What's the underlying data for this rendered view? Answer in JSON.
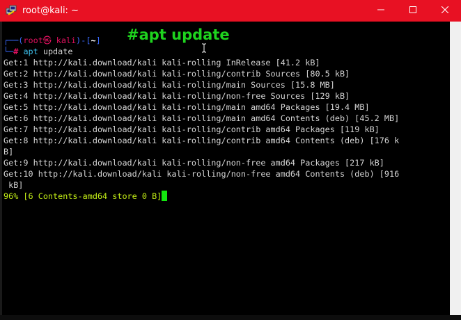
{
  "window": {
    "title": "root@kali: ~",
    "icon": "putty-icon",
    "accent_color": "#e81123"
  },
  "titlebar_buttons": {
    "minimize": "minimize-icon",
    "maximize": "maximize-icon",
    "close": "close-icon"
  },
  "annotation": "#apt update",
  "prompt": {
    "corner_top": "┌──(",
    "user": "root㉿ kali",
    "mid": ")-[",
    "path": "~",
    "close": "]",
    "corner_bottom": "└─",
    "hash": "#",
    "command": "apt",
    "args": " update"
  },
  "output_lines": [
    "Get:1 http://kali.download/kali kali-rolling InRelease [41.2 kB]",
    "Get:2 http://kali.download/kali kali-rolling/contrib Sources [80.5 kB]",
    "Get:3 http://kali.download/kali kali-rolling/main Sources [15.8 MB]",
    "Get:4 http://kali.download/kali kali-rolling/non-free Sources [129 kB]",
    "Get:5 http://kali.download/kali kali-rolling/main amd64 Packages [19.4 MB]",
    "Get:6 http://kali.download/kali kali-rolling/main amd64 Contents (deb) [45.2 MB]",
    "Get:7 http://kali.download/kali kali-rolling/contrib amd64 Packages [119 kB]",
    "Get:8 http://kali.download/kali kali-rolling/contrib amd64 Contents (deb) [176 k",
    "B]",
    "Get:9 http://kali.download/kali kali-rolling/non-free amd64 Packages [217 kB]",
    "Get:10 http://kali.download/kali kali-rolling/non-free amd64 Contents (deb) [916",
    " kB]"
  ],
  "progress": "96% [6 Contents-amd64 store 0 B]"
}
